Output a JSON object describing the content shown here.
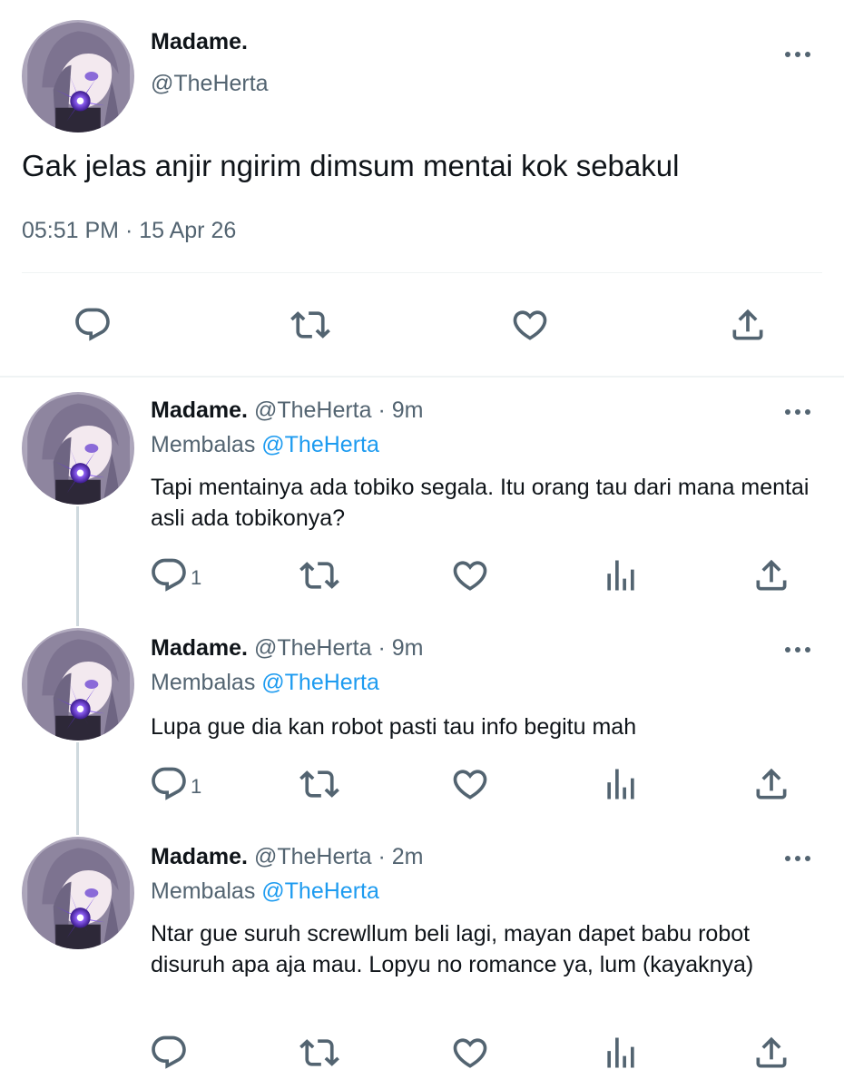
{
  "main_tweet": {
    "display_name": "Madame.",
    "handle": "@TheHerta",
    "text": "Gak jelas anjir ngirim dimsum mentai kok sebakul",
    "timestamp": "05:51 PM · 15 Apr 26"
  },
  "replies": [
    {
      "display_name": "Madame.",
      "handle": "@TheHerta",
      "separator": "·",
      "time": "9m",
      "replying_prefix": "Membalas",
      "replying_to": "@TheHerta",
      "text": "Tapi mentainya ada tobiko segala. Itu orang tau dari mana mentai asli ada tobikonya?",
      "reply_count": "1"
    },
    {
      "display_name": "Madame.",
      "handle": "@TheHerta",
      "separator": "·",
      "time": "9m",
      "replying_prefix": "Membalas",
      "replying_to": "@TheHerta",
      "text": "Lupa gue dia kan robot pasti tau info begitu mah",
      "reply_count": "1"
    },
    {
      "display_name": "Madame.",
      "handle": "@TheHerta",
      "separator": "·",
      "time": "2m",
      "replying_prefix": "Membalas",
      "replying_to": "@TheHerta",
      "text": "Ntar gue suruh screwllum beli lagi, mayan dapet babu robot disuruh apa aja mau. Lopyu no romance ya, lum (kayaknya)",
      "reply_count": ""
    }
  ],
  "icons": [
    "more-icon",
    "reply-icon",
    "retweet-icon",
    "like-icon",
    "share-icon",
    "analytics-icon"
  ],
  "colors": {
    "text": "#0f1419",
    "secondary": "#536471",
    "link": "#1d9bf0",
    "divider": "#eff3f4",
    "thread_line": "#cfd9de"
  }
}
